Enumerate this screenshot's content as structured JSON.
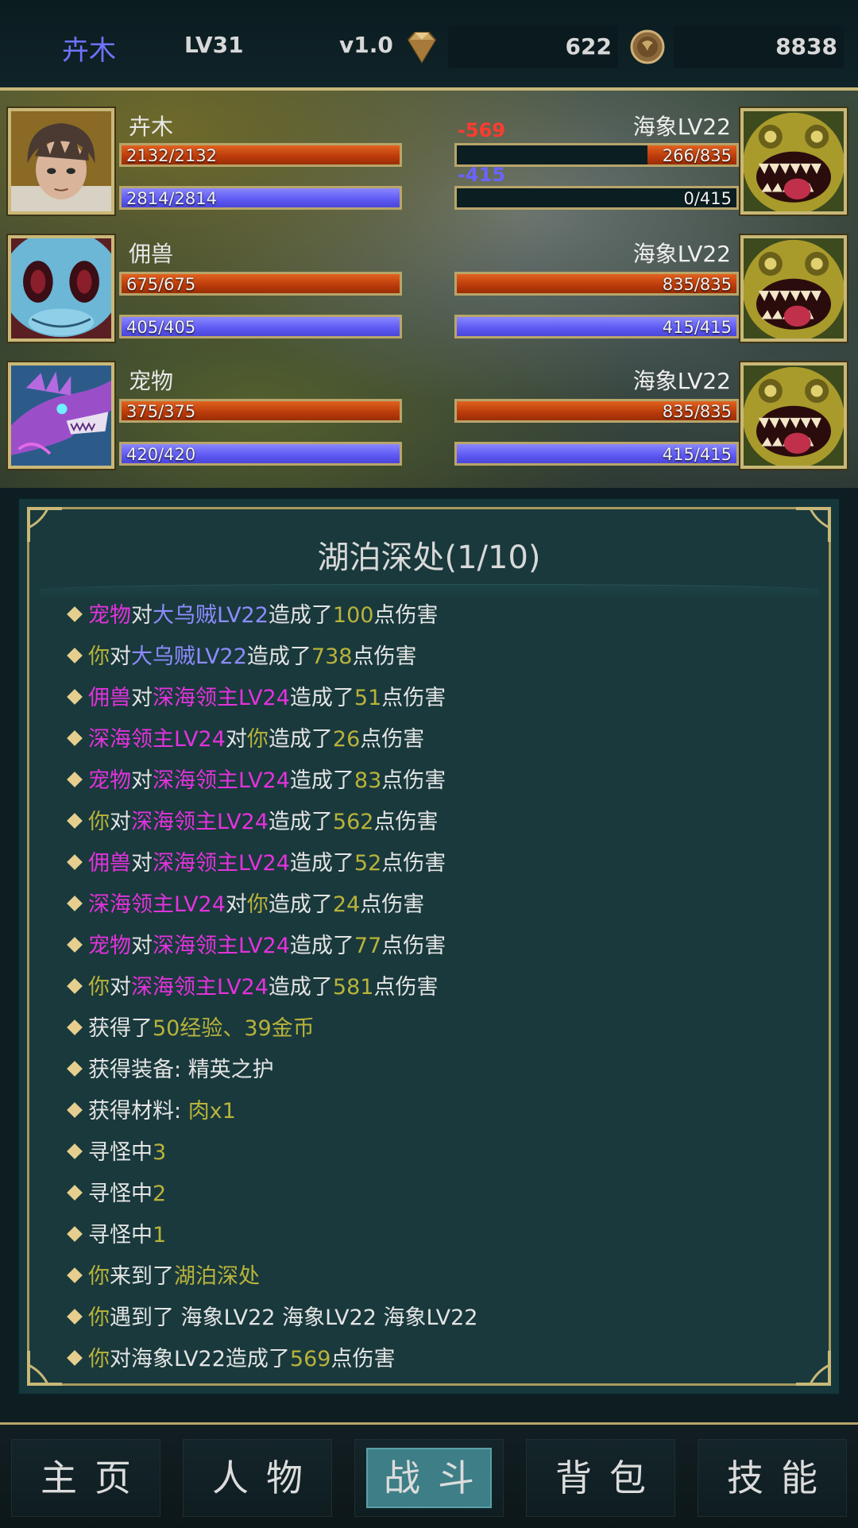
{
  "topbar": {
    "player_name": "卉木",
    "level": "LV31",
    "version": "v1.0",
    "gems": "622",
    "coins": "8838",
    "icons": [
      "diamond-icon",
      "coin-icon"
    ]
  },
  "allies": [
    {
      "name": "卉木",
      "hp_text": "2132/2132",
      "hp_fraction": 1.0,
      "mp_text": "2814/2814",
      "mp_fraction": 1.0,
      "name_color": "#d936d3",
      "portrait": "hero-boy-portrait"
    },
    {
      "name": "佣兽",
      "hp_text": "675/675",
      "hp_fraction": 1.0,
      "mp_text": "405/405",
      "mp_fraction": 1.0,
      "name_color": "#d936d3",
      "portrait": "blue-fish-creature-portrait"
    },
    {
      "name": "宠物",
      "hp_text": "375/375",
      "hp_fraction": 1.0,
      "mp_text": "420/420",
      "mp_fraction": 1.0,
      "name_color": "#d936d3",
      "portrait": "purple-dragon-portrait"
    }
  ],
  "enemies": [
    {
      "name": "海象LV22",
      "hp_text": "266/835",
      "hp_fraction": 0.3186,
      "mp_text": "0/415",
      "mp_fraction": 0.0,
      "hp_damage": "-569",
      "mp_damage": "-415",
      "portrait": "yellow-toothed-monster-portrait"
    },
    {
      "name": "海象LV22",
      "hp_text": "835/835",
      "hp_fraction": 1.0,
      "mp_text": "415/415",
      "mp_fraction": 1.0,
      "portrait": "yellow-toothed-monster-portrait"
    },
    {
      "name": "海象LV22",
      "hp_text": "835/835",
      "hp_fraction": 1.0,
      "mp_text": "415/415",
      "mp_fraction": 1.0,
      "portrait": "yellow-toothed-monster-portrait"
    }
  ],
  "log": {
    "title": "湖泊深处(1/10)",
    "entries": [
      [
        [
          "宠物",
          "mag"
        ],
        [
          "对",
          "white"
        ],
        [
          "大乌贼LV22",
          "blue"
        ],
        [
          "造成了",
          "white"
        ],
        [
          "100",
          "yel"
        ],
        [
          "点伤害",
          "white"
        ]
      ],
      [
        [
          "你",
          "yel"
        ],
        [
          "对",
          "white"
        ],
        [
          "大乌贼LV22",
          "blue"
        ],
        [
          "造成了",
          "white"
        ],
        [
          "738",
          "yel"
        ],
        [
          "点伤害",
          "white"
        ]
      ],
      [
        [
          "佣兽",
          "mag"
        ],
        [
          "对",
          "white"
        ],
        [
          "深海领主LV24",
          "mag"
        ],
        [
          "造成了",
          "white"
        ],
        [
          "51",
          "yel"
        ],
        [
          "点伤害",
          "white"
        ]
      ],
      [
        [
          "深海领主LV24",
          "mag"
        ],
        [
          "对",
          "white"
        ],
        [
          "你",
          "yel"
        ],
        [
          "造成了",
          "white"
        ],
        [
          "26",
          "yel"
        ],
        [
          "点伤害",
          "white"
        ]
      ],
      [
        [
          "宠物",
          "mag"
        ],
        [
          "对",
          "white"
        ],
        [
          "深海领主LV24",
          "mag"
        ],
        [
          "造成了",
          "white"
        ],
        [
          "83",
          "yel"
        ],
        [
          "点伤害",
          "white"
        ]
      ],
      [
        [
          "你",
          "yel"
        ],
        [
          "对",
          "white"
        ],
        [
          "深海领主LV24",
          "mag"
        ],
        [
          "造成了",
          "white"
        ],
        [
          "562",
          "yel"
        ],
        [
          "点伤害",
          "white"
        ]
      ],
      [
        [
          "佣兽",
          "mag"
        ],
        [
          "对",
          "white"
        ],
        [
          "深海领主LV24",
          "mag"
        ],
        [
          "造成了",
          "white"
        ],
        [
          "52",
          "yel"
        ],
        [
          "点伤害",
          "white"
        ]
      ],
      [
        [
          "深海领主LV24",
          "mag"
        ],
        [
          "对",
          "white"
        ],
        [
          "你",
          "yel"
        ],
        [
          "造成了",
          "white"
        ],
        [
          "24",
          "yel"
        ],
        [
          "点伤害",
          "white"
        ]
      ],
      [
        [
          "宠物",
          "mag"
        ],
        [
          "对",
          "white"
        ],
        [
          "深海领主LV24",
          "mag"
        ],
        [
          "造成了",
          "white"
        ],
        [
          "77",
          "yel"
        ],
        [
          "点伤害",
          "white"
        ]
      ],
      [
        [
          "你",
          "yel"
        ],
        [
          "对",
          "white"
        ],
        [
          "深海领主LV24",
          "mag"
        ],
        [
          "造成了",
          "white"
        ],
        [
          "581",
          "yel"
        ],
        [
          "点伤害",
          "white"
        ]
      ],
      [
        [
          "获得了",
          "white"
        ],
        [
          "50经验、39金币",
          "yel"
        ]
      ],
      [
        [
          "获得装备: ",
          "white"
        ],
        [
          "精英之护",
          "white"
        ]
      ],
      [
        [
          "获得材料: ",
          "white"
        ],
        [
          "肉x1",
          "yel"
        ]
      ],
      [
        [
          "寻怪中",
          "white"
        ],
        [
          "3",
          "yel"
        ]
      ],
      [
        [
          "寻怪中",
          "white"
        ],
        [
          "2",
          "yel"
        ]
      ],
      [
        [
          "寻怪中",
          "white"
        ],
        [
          "1",
          "yel"
        ]
      ],
      [
        [
          "你",
          "yel"
        ],
        [
          "来到了",
          "white"
        ],
        [
          "湖泊深处",
          "yel"
        ]
      ],
      [
        [
          "你",
          "yel"
        ],
        [
          "遇到了 海象LV22 海象LV22 海象LV22",
          "white"
        ]
      ],
      [
        [
          "你",
          "yel"
        ],
        [
          "对海象LV22造成了",
          "white"
        ],
        [
          "569",
          "yel"
        ],
        [
          "点伤害",
          "white"
        ]
      ]
    ]
  },
  "nav": {
    "items": [
      {
        "label": "主页",
        "active": false
      },
      {
        "label": "人物",
        "active": false
      },
      {
        "label": "战斗",
        "active": true
      },
      {
        "label": "背包",
        "active": false
      },
      {
        "label": "技能",
        "active": false
      }
    ]
  },
  "colors": {
    "magenta": "#e332dc",
    "blue": "#8d8cff",
    "yellow": "#b9b33a",
    "gold_border": "#c9b877",
    "hp": "#c9460f",
    "mp": "#5c58f2"
  }
}
